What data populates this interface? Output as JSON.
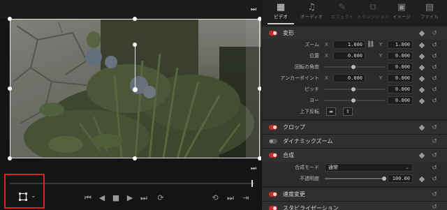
{
  "inspector": {
    "tabs": [
      {
        "label": "ビデオ",
        "icon": "film-icon",
        "state": "active"
      },
      {
        "label": "オーディオ",
        "icon": "music-note-icon",
        "state": "normal"
      },
      {
        "label": "エフェクト",
        "icon": "magic-wand-icon",
        "state": "disabled"
      },
      {
        "label": "トランジション",
        "icon": "transition-icon",
        "state": "disabled"
      },
      {
        "label": "イメージ",
        "icon": "image-icon",
        "state": "normal"
      },
      {
        "label": "ファイル",
        "icon": "file-icon",
        "state": "normal"
      }
    ],
    "transform": {
      "title": "変形",
      "zoom": {
        "label": "ズーム",
        "x_axis": "X",
        "x": "1.000",
        "y_axis": "Y",
        "y": "1.000"
      },
      "position": {
        "label": "位置",
        "x_axis": "X",
        "x": "0.000",
        "y_axis": "Y",
        "y": "0.000"
      },
      "rotation": {
        "label": "回転の角度",
        "value": "0.000"
      },
      "anchor": {
        "label": "アンカーポイント",
        "x_axis": "X",
        "x": "0.000",
        "y_axis": "Y",
        "y": "0.000"
      },
      "pitch": {
        "label": "ピッチ",
        "value": "0.000"
      },
      "yaw": {
        "label": "ヨー",
        "value": "0.000"
      },
      "flip": {
        "label": "上下反転"
      }
    },
    "crop": {
      "title": "クロップ"
    },
    "dynamic_zoom": {
      "title": "ダイナミックズーム"
    },
    "composite": {
      "title": "合成",
      "mode_label": "合成モード",
      "mode_value": "通常",
      "opacity_label": "不透明度",
      "opacity_value": "100.00"
    },
    "speed_change": {
      "title": "速度変更"
    },
    "stabilization": {
      "title": "スタビライゼーション"
    }
  },
  "colors": {
    "accent_red": "#cc2b2b",
    "highlight_box": "#e02020",
    "panel_bg": "#262626",
    "viewer_bg": "#141414"
  }
}
